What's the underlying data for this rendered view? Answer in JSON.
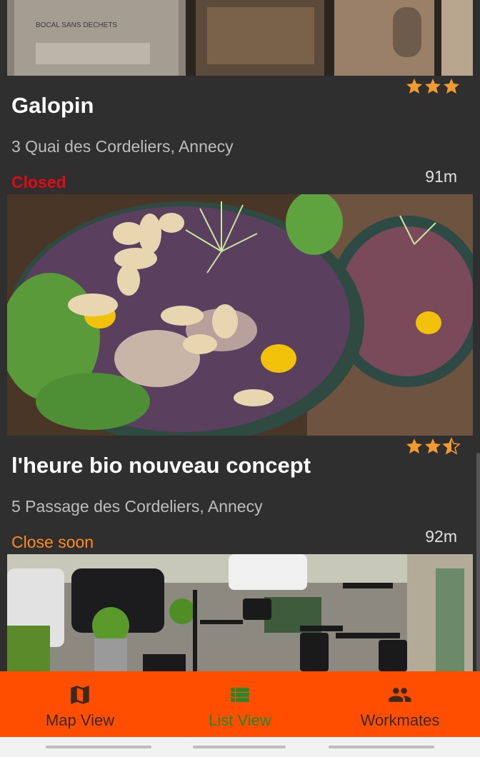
{
  "restaurants": [
    {
      "name": "Galopin",
      "address": "3 Quai des Cordeliers, Annecy",
      "status": "Closed",
      "status_color": "#e50914",
      "distance": "91m",
      "rating": 3,
      "photo": "storefront-photo",
      "photo_sign_text": "BOCAL SANS DECHETS"
    },
    {
      "name": "l'heure bio nouveau concept",
      "address": "5 Passage des Cordeliers, Annecy",
      "status": "Close soon",
      "status_color": "#ff8c1a",
      "distance": "92m",
      "rating": 2.5,
      "photo": "salad-bowl-photo"
    },
    {
      "name": "",
      "photo": "terrace-photo"
    }
  ],
  "bottom_nav": [
    {
      "label": "Map View",
      "icon": "map-icon",
      "color": "#3a2a20",
      "active": false
    },
    {
      "label": "List View",
      "icon": "list-icon",
      "color": "#1e8a2e",
      "active": true
    },
    {
      "label": "Workmates",
      "icon": "people-icon",
      "color": "#3a2a20",
      "active": false
    }
  ],
  "colors": {
    "background": "#2f2f2f",
    "accent": "#ff4e00",
    "star": "#f29a2e"
  }
}
